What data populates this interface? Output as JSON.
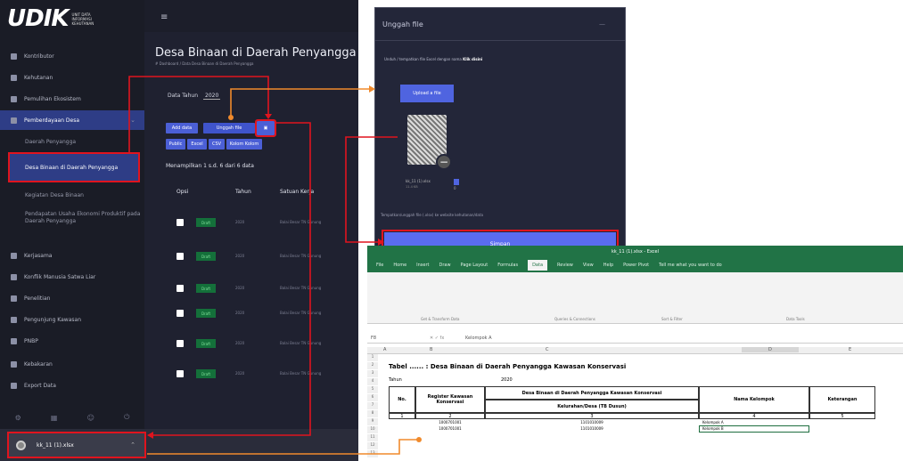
{
  "app": {
    "logo": "UDIK",
    "logo_sub": "UNIT DATA INFORMASI KEHUTANAN",
    "sidebar": {
      "items": [
        {
          "label": "Kontributor"
        },
        {
          "label": "Kehutanan"
        },
        {
          "label": "Pemulihan Ekosistem"
        },
        {
          "label": "Pemberdayaan Desa"
        },
        {
          "label": "Daerah Penyangga"
        },
        {
          "label": "Desa Binaan di Daerah Penyangga"
        },
        {
          "label": "Kegiatan Desa Binaan"
        },
        {
          "label": "Pendapatan Usaha Ekonomi Produktif pada Daerah Penyangga"
        },
        {
          "label": "Kerjasama"
        },
        {
          "label": "Konflik Manusia Satwa Liar"
        },
        {
          "label": "Penelitian"
        },
        {
          "label": "Pengunjung Kawasan"
        },
        {
          "label": "PNBP"
        },
        {
          "label": "Kebakaran"
        },
        {
          "label": "Export Data"
        }
      ]
    },
    "page_title": "Desa Binaan di Daerah Penyangga",
    "breadcrumb": "# Dashboard / Data Desa Binaan di Daerah Penyangga",
    "year_label": "Data Tahun",
    "year_value": "2020",
    "buttons": {
      "add": "Add data",
      "upload": "Unggah file",
      "excel_icon": "▣",
      "public": "Public",
      "excel": "Excel",
      "csv": "CSV",
      "columns": "Kolom Kolom"
    },
    "show_info": "Menampilkan 1 s.d. 6 dari 6 data",
    "table": {
      "headers": [
        "Opsi",
        "Tahun",
        "Satuan Kerja"
      ],
      "rows": [
        {
          "status": "Draft",
          "year": "2020",
          "unit": "Balai Besar TN Gunung"
        },
        {
          "status": "Draft",
          "year": "2020",
          "unit": "Balai Besar TN Gunung"
        },
        {
          "status": "Draft",
          "year": "2020",
          "unit": "Balai Besar TN Gunung"
        },
        {
          "status": "Draft",
          "year": "2020",
          "unit": "Balai Besar TN Gunung"
        },
        {
          "status": "Draft",
          "year": "2020",
          "unit": "Balai Besar TN Gunung"
        },
        {
          "status": "Draft",
          "year": "2020",
          "unit": "Balai Besar TN Gunung"
        }
      ]
    },
    "download_file": "kk_11 (1).xlsx"
  },
  "dialog": {
    "title": "Unggah file",
    "close": "—",
    "instruction": "Unduh / tempatkan file Excel dengan nama",
    "instruction_bold": "Klik disini",
    "upload_button": "Upload a file",
    "file_name": "kk_11 (1).xlsx",
    "file_size": "11.4 KB",
    "file_pct": "0",
    "path": "Tempatkan/unggah file (.xlsx) ke website kehutanan/data",
    "save_button": "Simpan"
  },
  "excel": {
    "title": "kk_11 (1).xlsx - Excel",
    "tabs": [
      "File",
      "Home",
      "Insert",
      "Draw",
      "Page Layout",
      "Formulas",
      "Data",
      "Review",
      "View",
      "Help",
      "Power Pivot",
      "Tell me what you want to do"
    ],
    "selected_tab": "Data",
    "ribbon_groups": [
      "Get & Transform Data",
      "Queries & Connections",
      "Sort & Filter",
      "Data Tools"
    ],
    "name_box": "F8",
    "formula": "Kelompok A",
    "columns": [
      "A",
      "B",
      "C",
      "D",
      "E"
    ],
    "sheet_title": "Tabel ...... : Desa Binaan di Daerah Penyangga Kawasan Konservasi",
    "tahun_label": "Tahun",
    "tahun_value": "2020",
    "headers": {
      "no": "No.",
      "bagian": "Register Kawasan Konservasi",
      "desa": "Desa Binaan di Daerah Penyangga Kawasan Konservasi",
      "desa_sub": "Kelurahan/Desa (TB Dusun)",
      "kelompok": "Nama Kelompok",
      "ket": "Keterangan"
    },
    "index_row": [
      "1",
      "2",
      "3",
      "4",
      "5"
    ],
    "data_rows": [
      {
        "bagian": "1000701001",
        "desa": "1101010009",
        "kelompok": "Kelompok A"
      },
      {
        "bagian": "1000701001",
        "desa": "1101010009",
        "kelompok": "Kelompok B"
      }
    ],
    "row_numbers": [
      "1",
      "2",
      "3",
      "4",
      "5",
      "6",
      "7",
      "8",
      "9",
      "10",
      "11",
      "12",
      "13"
    ]
  },
  "colors": {
    "highlight": "#e0141e",
    "connector": "#f08a2c",
    "primary": "#4b5fd6",
    "excel_green": "#217346"
  }
}
